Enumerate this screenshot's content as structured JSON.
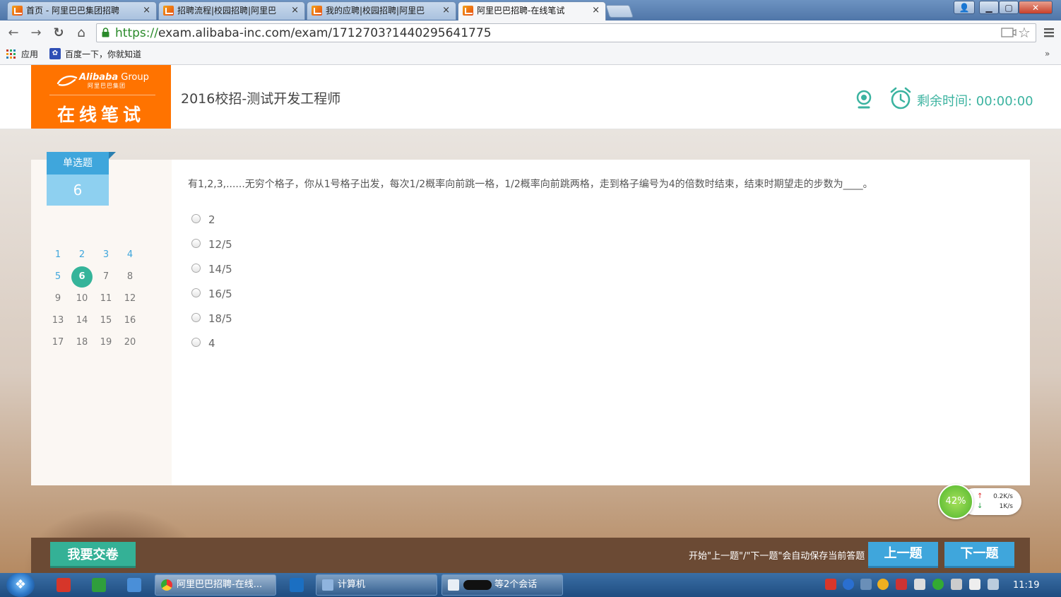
{
  "browser": {
    "tabs": [
      {
        "label": "首页 - 阿里巴巴集团招聘",
        "active": false
      },
      {
        "label": "招聘流程|校园招聘|阿里巴",
        "active": false
      },
      {
        "label": "我的应聘|校园招聘|阿里巴",
        "active": false
      },
      {
        "label": "阿里巴巴招聘-在线笔试",
        "active": true
      }
    ],
    "tab_close": "×",
    "window_buttons": {
      "minimize": "▁",
      "maximize": "▢",
      "close": "✕"
    },
    "url_scheme": "https://",
    "url_rest": "exam.alibaba-inc.com/exam/1712703?1440295641775",
    "bookmarks": [
      "应用",
      "百度一下，你就知道"
    ],
    "more": "»",
    "icons": [
      "back-icon",
      "forward-icon",
      "reload-icon",
      "home-icon",
      "lock-icon",
      "cast-icon",
      "star-icon",
      "menu-icon"
    ]
  },
  "header": {
    "brand": "Alibaba",
    "brand_group": "Group",
    "brand_cn": "阿里巴巴集团",
    "logo_title": "在线笔试",
    "exam_title": "2016校招-测试开发工程师",
    "timer_label": "剩余时间: 00:00:00",
    "accent": "#ff7300"
  },
  "sidebar": {
    "question_type": "单选题",
    "current_number": "6",
    "numbers": [
      "1",
      "2",
      "3",
      "4",
      "5",
      "6",
      "7",
      "8",
      "9",
      "10",
      "11",
      "12",
      "13",
      "14",
      "15",
      "16",
      "17",
      "18",
      "19",
      "20"
    ],
    "answered": [
      "1",
      "2",
      "3",
      "4",
      "5"
    ],
    "current": "6"
  },
  "question": {
    "text": "有1,2,3,......无穷个格子，你从1号格子出发，每次1/2概率向前跳一格，1/2概率向前跳两格，走到格子编号为4的倍数时结束，结束时期望走的步数为____。",
    "options": [
      "2",
      "12/5",
      "14/5",
      "16/5",
      "18/5",
      "4"
    ]
  },
  "footer": {
    "submit_label": "我要交卷",
    "autosave_note": "开始\"上一题\"/\"下一题\"会自动保存当前答题",
    "prev_label": "上一题",
    "next_label": "下一题",
    "accent": "#3fa6dc",
    "submit_color": "#34b196"
  },
  "speed_widget": {
    "percent": "42%",
    "up": "0.2K/s",
    "down": "1K/s"
  },
  "taskbar": {
    "start": "❖",
    "tasks": [
      "阿里巴巴招聘-在线...",
      "计算机",
      "等2个会话"
    ],
    "clock": "11:19"
  }
}
